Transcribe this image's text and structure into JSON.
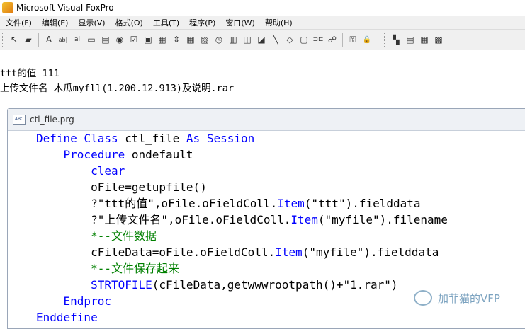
{
  "window": {
    "title": "Microsoft Visual FoxPro"
  },
  "menu": [
    {
      "label": "文件(F)"
    },
    {
      "label": "编辑(E)"
    },
    {
      "label": "显示(V)"
    },
    {
      "label": "格式(O)"
    },
    {
      "label": "工具(T)"
    },
    {
      "label": "程序(P)"
    },
    {
      "label": "窗口(W)"
    },
    {
      "label": "帮助(H)"
    }
  ],
  "toolbar": {
    "pointer_icon": "↖",
    "lock_icon": "▰",
    "label_icon": "A",
    "textbox_icon": "ab|",
    "editbox_icon": "al",
    "commandbutton_icon": "▭",
    "commandgroup_icon": "▤",
    "optiongroup_icon": "◉",
    "checkbox_icon": "☑",
    "combobox_icon": "▣",
    "listbox_icon": "▦",
    "spinner_icon": "⇕",
    "grid_icon": "▦",
    "image_icon": "▨",
    "timer_icon": "◷",
    "pageframe_icon": "▥",
    "olecontrol_icon": "◫",
    "oleboundcontrol_icon": "◪",
    "line_icon": "╲",
    "shape_icon": "◇",
    "container_icon": "▢",
    "separator_icon": "⊐⊏",
    "hyperlink_icon": "☍",
    "builder_lock_icon": "⚿",
    "buttonlock_icon": "🔒",
    "form_icon": "▚",
    "report_icon": "▤",
    "dataenv_icon": "▦",
    "classbrowser_icon": "▩"
  },
  "output": {
    "line1": "ttt的值 111",
    "line2": "上传文件名 木瓜myfll(1.200.12.913)及说明.rar"
  },
  "editor": {
    "title": "ctl_file.prg",
    "icon_label": "ABC",
    "code": {
      "l1_kw1": "Define Class",
      "l1_txt1": " ctl_file ",
      "l1_kw2": "As Session",
      "l2_indent": "    ",
      "l2_kw": "Procedure",
      "l2_txt": " ondefault",
      "l3_indent": "        ",
      "l3_kw": "clear",
      "l4": "        oFile=getupfile()",
      "l5_pre": "        ?\"ttt的值\",oFile.oFieldColl.",
      "l5_kw": "Item",
      "l5_post": "(\"ttt\").fielddata",
      "l6_pre": "        ?\"上传文件名\",oFile.oFieldColl.",
      "l6_kw": "Item",
      "l6_post": "(\"myfile\").filename",
      "l7_indent": "        ",
      "l7_cm": "*--文件数据",
      "l8_pre": "        cFileData=oFile.oFieldColl.",
      "l8_kw": "Item",
      "l8_post": "(\"myfile\").fielddata",
      "l9_indent": "        ",
      "l9_cm": "*--文件保存起来",
      "l10_indent": "        ",
      "l10_kw": "STRTOFILE",
      "l10_post": "(cFileData,getwwwrootpath()+\"1.rar\")",
      "l11_indent": "    ",
      "l11_kw": "Endproc",
      "l12_kw": "Enddefine"
    }
  },
  "watermark": {
    "text": "加菲猫的VFP"
  }
}
